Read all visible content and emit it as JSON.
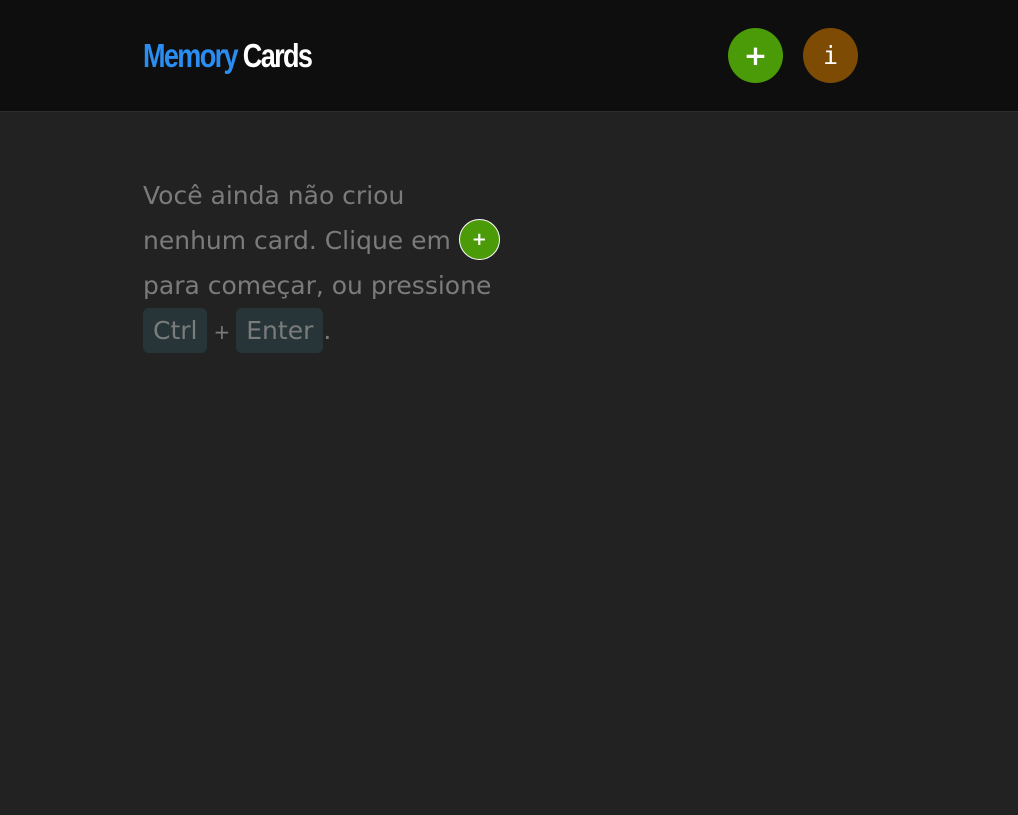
{
  "header": {
    "logo": {
      "word1": "Memory",
      "word2": "Cards"
    },
    "add_button_label": "+",
    "info_button_label": "i"
  },
  "empty_state": {
    "text_before": "Você ainda não criou nenhum card. Clique em",
    "inline_add_label": "+",
    "text_middle": "para começar, ou pressione",
    "key1": "Ctrl",
    "plus": "+",
    "key2": "Enter",
    "text_end": "."
  },
  "colors": {
    "header_bg": "#0e0e0e",
    "page_bg": "#222222",
    "logo_accent": "#2a8df2",
    "add_green": "#4a9b07",
    "info_brown": "#7d4b04",
    "text_muted": "#7b7b7b",
    "kbd_bg": "#273539"
  },
  "icons": {
    "add": "plus-icon",
    "info": "info-icon"
  }
}
